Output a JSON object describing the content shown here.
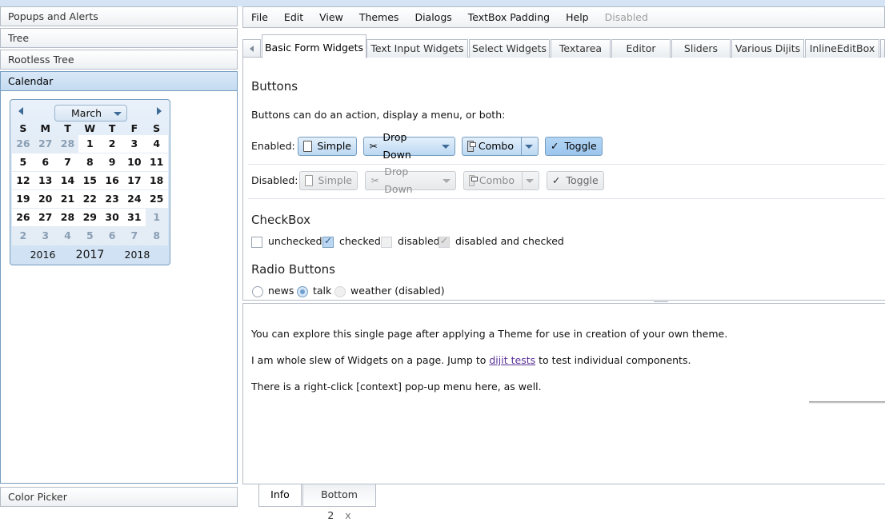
{
  "accordion": {
    "panes": [
      "Popups and Alerts",
      "Tree",
      "Rootless Tree",
      "Calendar"
    ],
    "bottom_pane": "Color Picker"
  },
  "calendar": {
    "month": "March",
    "weekdays": [
      "S",
      "M",
      "T",
      "W",
      "T",
      "F",
      "S"
    ],
    "weeks": [
      [
        "26",
        "27",
        "28",
        "1",
        "2",
        "3",
        "4"
      ],
      [
        "5",
        "6",
        "7",
        "8",
        "9",
        "10",
        "11"
      ],
      [
        "12",
        "13",
        "14",
        "15",
        "16",
        "17",
        "18"
      ],
      [
        "19",
        "20",
        "21",
        "22",
        "23",
        "24",
        "25"
      ],
      [
        "26",
        "27",
        "28",
        "29",
        "30",
        "31",
        "1"
      ],
      [
        "2",
        "3",
        "4",
        "5",
        "6",
        "7",
        "8"
      ]
    ],
    "years": [
      "2016",
      "2017",
      "2018"
    ]
  },
  "menu": [
    "File",
    "Edit",
    "View",
    "Themes",
    "Dialogs",
    "TextBox Padding",
    "Help",
    "Disabled"
  ],
  "tabs": [
    "Basic Form Widgets",
    "Text Input Widgets",
    "Select Widgets",
    "Textarea",
    "Editor",
    "Sliders",
    "Various Dijits",
    "InlineEditBox"
  ],
  "buttons_section": {
    "title": "Buttons",
    "description": "Buttons can do an action, display a menu, or both:",
    "enabled_label": "Enabled:",
    "disabled_label": "Disabled:",
    "simple": "Simple",
    "dropdown": "Drop Down",
    "combo": "Combo",
    "toggle": "Toggle"
  },
  "checkbox_section": {
    "title": "CheckBox",
    "unchecked": "unchecked",
    "checked": "checked",
    "disabled": "disabled",
    "disabled_checked": "disabled and checked"
  },
  "radio_section": {
    "title": "Radio Buttons",
    "news": "news",
    "talk": "talk",
    "weather": "weather (disabled)"
  },
  "info": {
    "line1": "You can explore this single page after applying a Theme for use in creation of your own theme.",
    "line2_before": "I am whole slew of Widgets on a page. Jump to",
    "line2_link": "dijit tests",
    "line2_after": "to test individual components.",
    "line3": "There is a right-click [context] pop-up menu here, as well."
  },
  "bottom_tabs": {
    "info": "Info",
    "bottom2": "Bottom 2",
    "close": "x"
  }
}
